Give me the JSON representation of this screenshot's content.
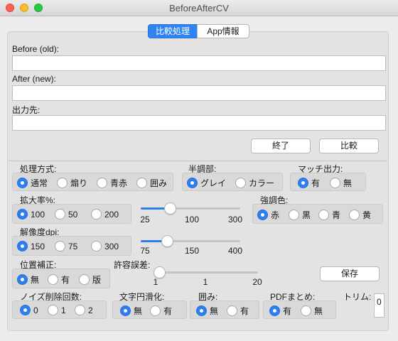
{
  "window": {
    "title": "BeforeAfterCV"
  },
  "colors": {
    "accent": "#2b7ff0",
    "close": "#fc5f57",
    "minimize": "#fdbc2e",
    "zoom": "#28c840"
  },
  "tabs": [
    {
      "label": "比較処理",
      "selected": true
    },
    {
      "label": "App情報",
      "selected": false
    }
  ],
  "paths": {
    "before_label": "Before (old):",
    "before_value": "",
    "after_label": "After (new):",
    "after_value": "",
    "output_label": "出力先:",
    "output_value": ""
  },
  "buttons": {
    "quit": "終了",
    "compare": "比較",
    "save": "保存"
  },
  "processing": {
    "label": "処理方式:",
    "options": [
      "通常",
      "煽り",
      "青赤",
      "囲み"
    ],
    "selected": 0
  },
  "halftone": {
    "label": "半調部:",
    "options": [
      "グレイ",
      "カラー"
    ],
    "selected": 0
  },
  "match": {
    "label": "マッチ出力:",
    "options": [
      "有",
      "無"
    ],
    "selected": 0
  },
  "zoom": {
    "label": "拡大率%:",
    "options": [
      "100",
      "50",
      "200"
    ],
    "selected": 0,
    "slider_min": "25",
    "slider_mid": "100",
    "slider_max": "300",
    "slider_value": 100
  },
  "emphasis": {
    "label": "強調色:",
    "options": [
      "赤",
      "黒",
      "青",
      "黄"
    ],
    "selected": 0
  },
  "dpi": {
    "label": "解像度dpi:",
    "options": [
      "150",
      "75",
      "300"
    ],
    "selected": 0,
    "slider_min": "75",
    "slider_mid": "150",
    "slider_max": "400",
    "slider_value": 150
  },
  "align": {
    "label": "位置補正:",
    "options": [
      "無",
      "有",
      "版"
    ],
    "selected": 0
  },
  "tolerance": {
    "label": "許容誤差:",
    "slider_min": "1",
    "slider_mid": "1",
    "slider_max": "20",
    "slider_value": 1
  },
  "noise": {
    "label": "ノイズ削除回数:",
    "options": [
      "0",
      "1",
      "2"
    ],
    "selected": 0
  },
  "smoothing": {
    "label": "文字円滑化:",
    "options": [
      "無",
      "有"
    ],
    "selected": 0
  },
  "enclose": {
    "label": "囲み:",
    "options": [
      "無",
      "有"
    ],
    "selected": 0
  },
  "pdf": {
    "label": "PDFまとめ:",
    "options": [
      "有",
      "無"
    ],
    "selected": 0
  },
  "trim": {
    "label": "トリム:",
    "value": "0"
  }
}
